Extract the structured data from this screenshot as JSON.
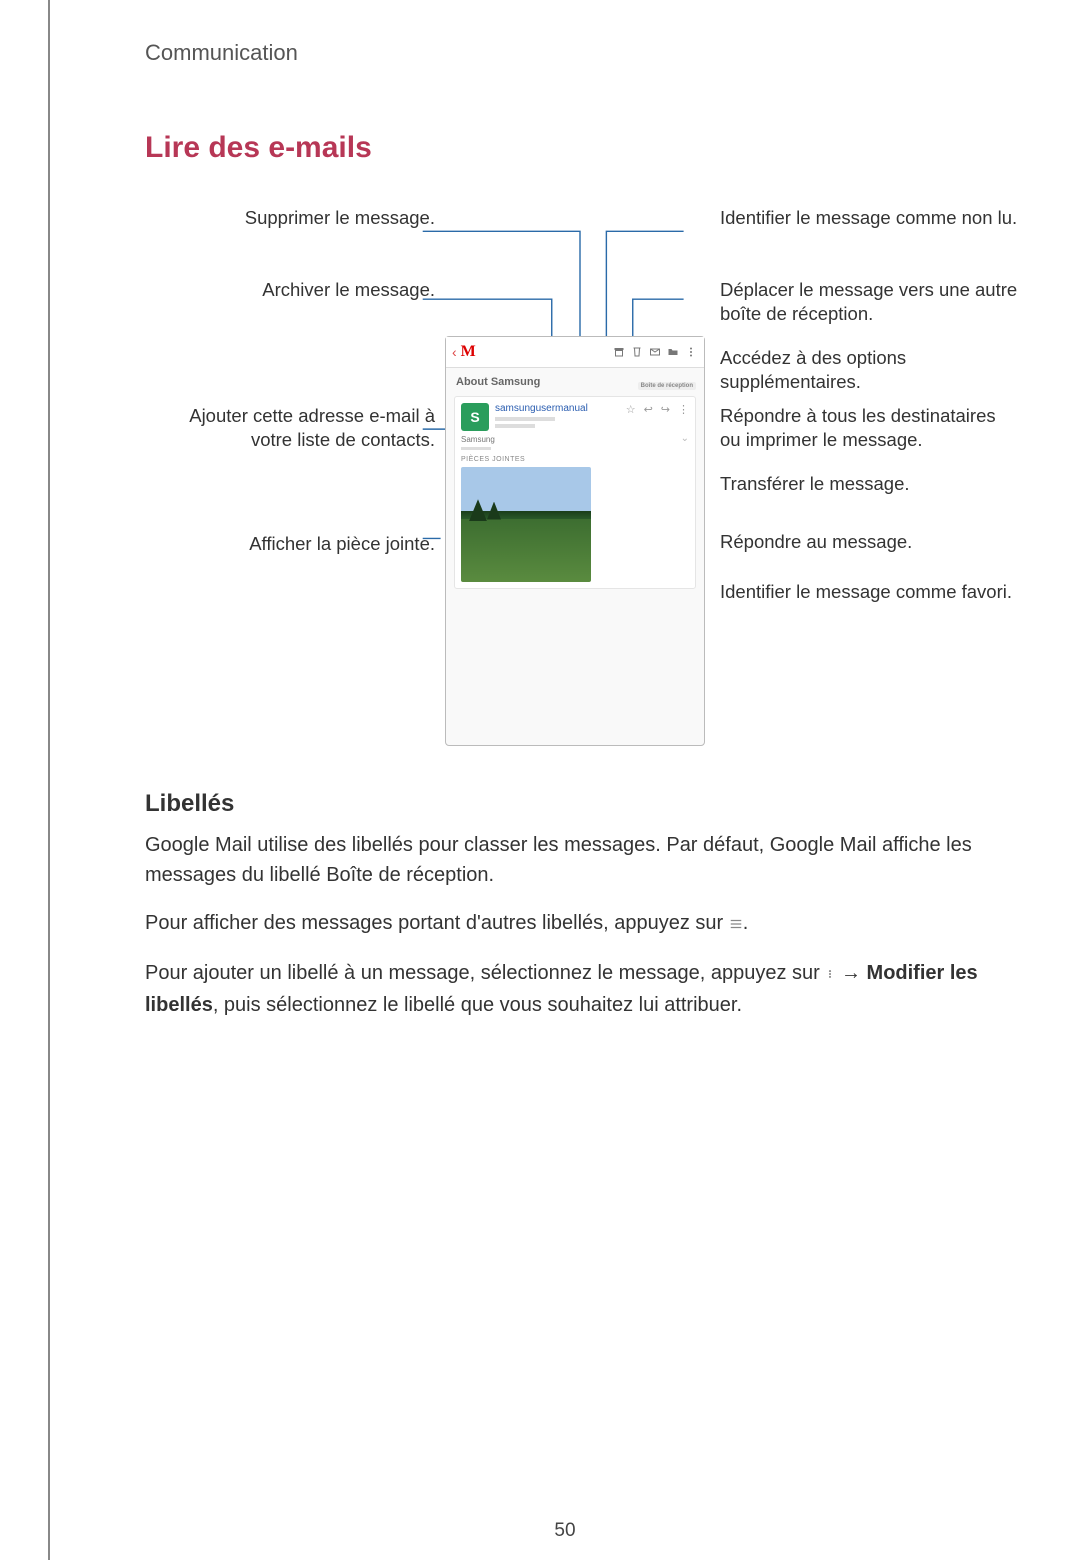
{
  "breadcrumb": "Communication",
  "section_title": "Lire des e-mails",
  "callouts": {
    "delete": "Supprimer le message.",
    "archive": "Archiver le message.",
    "add_contact": "Ajouter cette adresse e-mail à votre liste de contacts.",
    "attachment": "Afficher la pièce jointe.",
    "unread": "Identifier le message comme non lu.",
    "move": "Déplacer le message vers une autre boîte de réception.",
    "more_options": "Accédez à des options supplémentaires.",
    "reply_all": "Répondre à tous les destinataires ou imprimer le message.",
    "forward": "Transférer le message.",
    "reply": "Répondre au message.",
    "favorite": "Identifier le message comme favori."
  },
  "phone": {
    "subject": "About Samsung",
    "inbox_chip": "Boîte de réception",
    "sender_name": "samsungusermanual",
    "body_title": "Samsung",
    "attachments_label": "PIÈCES JOINTES",
    "avatar_initial": "S"
  },
  "subsection_title": "Libellés",
  "body": {
    "p1": "Google Mail utilise des libellés pour classer les messages. Par défaut, Google Mail affiche les messages du libellé Boîte de réception.",
    "p2_prefix": "Pour afficher des messages portant d'autres libellés, appuyez sur ",
    "p2_suffix": ".",
    "p3_prefix": "Pour ajouter un libellé à un message, sélectionnez le message, appuyez sur ",
    "p3_arrow": " → ",
    "p3_bold": "Modifier les libellés",
    "p3_suffix": ", puis sélectionnez le libellé que vous souhaitez lui attribuer."
  },
  "page_number": "50"
}
